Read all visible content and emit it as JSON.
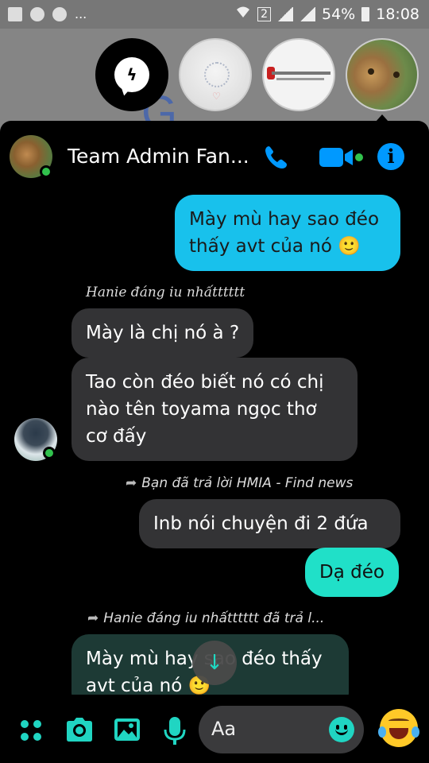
{
  "status_bar": {
    "sim_slot": "2",
    "battery_percent": "54%",
    "time": "18:08",
    "overflow": "..."
  },
  "chat_heads": [
    {
      "name": "messenger"
    },
    {
      "name": "contact-2"
    },
    {
      "name": "contact-3"
    },
    {
      "name": "contact-4"
    }
  ],
  "header": {
    "title": "Team Admin Fan..."
  },
  "messages": {
    "m1": "Mày mù hay sao đéo thấy avt của nó 🙂",
    "sender1": "Hanie đáng iu nhấtttttt",
    "m2": "Mày là chị nó à ?",
    "m3": "Tao còn đéo biết nó có chị nào tên toyama ngọc thơ cơ đấy",
    "reply1": "Bạn đã trả lời HMIA - Find news",
    "m4": "Inb nói chuyện đi 2 đứa",
    "m5": "Dạ đéo",
    "reply2": "Hanie đáng iu nhấtttttt đã trả l...",
    "m6": "Mày mù hay sao đéo thấy avt của nó 🙂"
  },
  "composer": {
    "placeholder": "Aa"
  },
  "colors": {
    "accent": "#0099ff",
    "teal": "#20e0c8",
    "outgoing_blue": "#18c1ec",
    "online": "#31c24d"
  }
}
